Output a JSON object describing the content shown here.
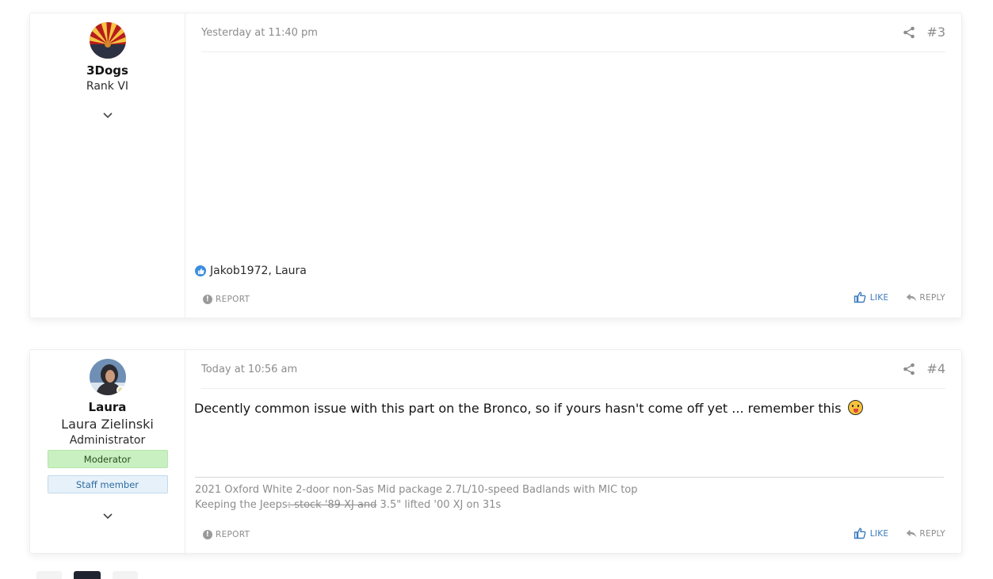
{
  "posts": [
    {
      "number": "#3",
      "timestamp": "Yesterday at 11:40 pm",
      "user": {
        "name": "3Dogs",
        "rank": "Rank VI"
      },
      "reactions": "Jakob1972, Laura",
      "actions": {
        "report": "REPORT",
        "like": "LIKE",
        "reply": "REPLY"
      }
    },
    {
      "number": "#4",
      "timestamp": "Today at 10:56 am",
      "user": {
        "name": "Laura",
        "real_name": "Laura Zielinski",
        "role": "Administrator",
        "banner_moderator": "Moderator",
        "banner_staff": "Staff member"
      },
      "message": "Decently common issue with this part on the Bronco, so if yours hasn't come off yet ... remember this",
      "signature": {
        "line1": "2021 Oxford White 2-door non-Sas Mid package 2.7L/10-speed Badlands with MIC top",
        "line2_prefix": "Keeping the Jeeps",
        "line2_strike": ": stock '89 XJ and",
        "line2_suffix": " 3.5\" lifted '00 XJ on 31s"
      },
      "actions": {
        "report": "REPORT",
        "like": "LIKE",
        "reply": "REPLY"
      }
    }
  ],
  "colors": {
    "accent": "#3c7bbd",
    "moderator_bg": "#c8f0c0",
    "staff_bg": "#e6f1fa"
  },
  "icons": [
    "chevron-down-icon",
    "share-icon",
    "thumbs-up-icon",
    "reply-icon",
    "report-icon",
    "like-reaction-icon",
    "tongue-out-emoji"
  ]
}
